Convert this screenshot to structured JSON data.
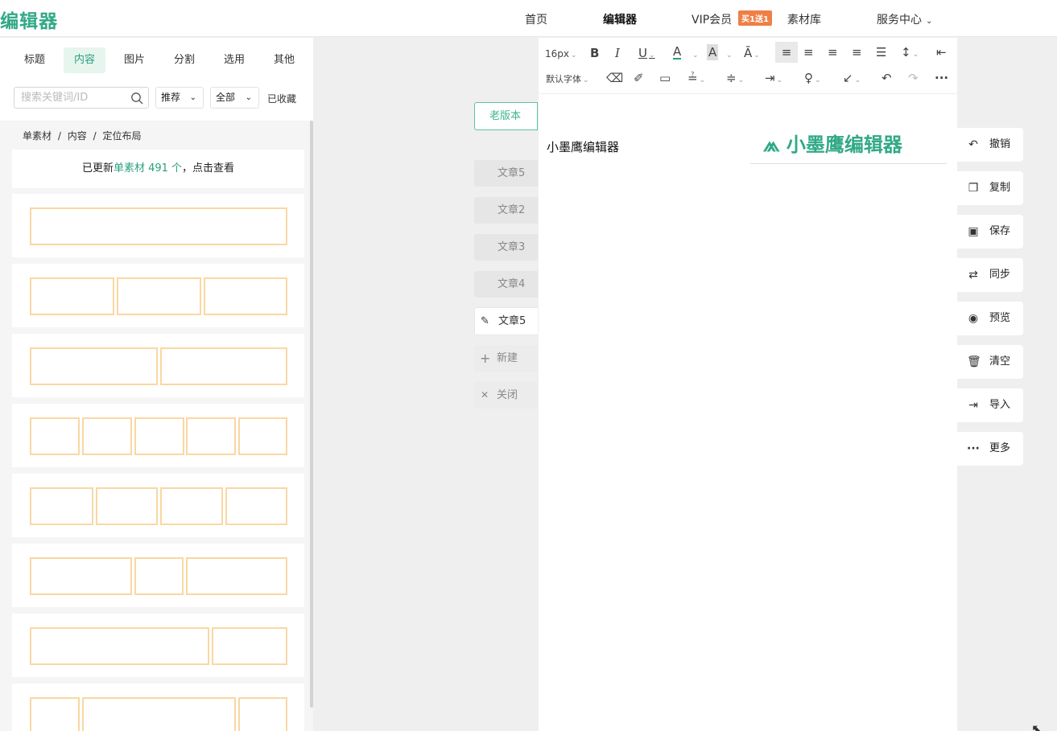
{
  "header": {
    "brand": "编辑器",
    "nav": {
      "home": "首页",
      "editor": "编辑器",
      "vip": "VIP会员",
      "vip_badge": "买1送1",
      "materials": "素材库",
      "service": "服务中心"
    }
  },
  "sidebar": {
    "tabs": [
      "标题",
      "内容",
      "图片",
      "分割",
      "选用",
      "其他"
    ],
    "active_tab": "内容",
    "search": {
      "placeholder": "搜索关键词/ID",
      "value": ""
    },
    "filter_recommend": "推荐",
    "filter_all": "全部",
    "favorites": "已收藏",
    "breadcrumb": [
      "单素材",
      "内容",
      "定位布局"
    ],
    "update": {
      "prefix": "已更新",
      "highlight": "单素材 491 个",
      "suffix": "，点击查看"
    }
  },
  "articles": {
    "old_version": "老版本",
    "items": [
      "文章5",
      "文章2",
      "文章3",
      "文章4",
      "文章5"
    ],
    "current_index": 4,
    "new_label": "新建",
    "close_label": "关闭"
  },
  "toolbar": {
    "font_size": "16px",
    "font_family": "默认字体"
  },
  "document": {
    "title": "小墨鹰编辑器",
    "logo_text": "小墨鹰编辑器"
  },
  "actions": {
    "undo": "撤销",
    "copy": "复制",
    "save": "保存",
    "sync": "同步",
    "preview": "预览",
    "clear": "清空",
    "import": "导入",
    "more": "更多"
  },
  "colors": {
    "accent": "#31a987",
    "layout_box": "#fad7a3",
    "vip_badge": "#ef7f46"
  },
  "icons": [
    "search-icon",
    "chevron-down-icon",
    "bold-icon",
    "italic-icon",
    "underline-icon",
    "font-color-icon",
    "highlight-icon",
    "eraser-icon",
    "brush-icon",
    "image-icon",
    "undo-icon",
    "redo-icon",
    "more-icon",
    "copy-icon",
    "save-icon",
    "sync-icon",
    "eye-icon",
    "trash-icon",
    "import-icon",
    "edit-icon",
    "plus-icon",
    "close-icon"
  ]
}
